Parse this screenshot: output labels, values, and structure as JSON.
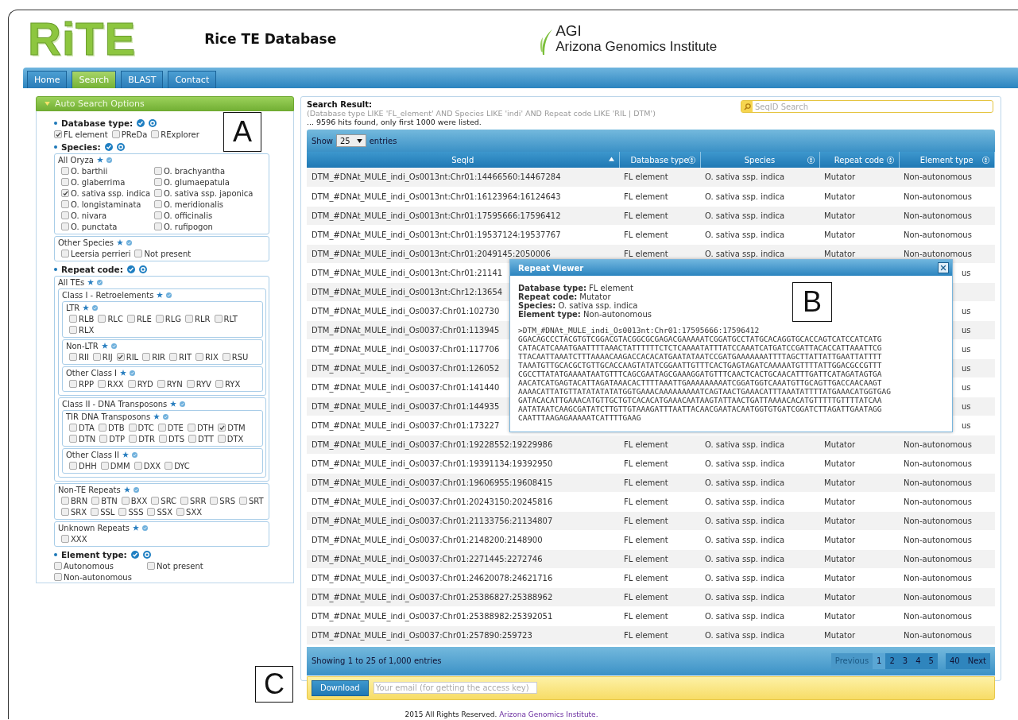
{
  "header": {
    "logo": "RiTE",
    "site_title": "Rice TE Database",
    "org_short": "AGI",
    "org_name": "Arizona Genomics Institute"
  },
  "nav": [
    {
      "label": "Home",
      "selected": false
    },
    {
      "label": "Search",
      "selected": true
    },
    {
      "label": "BLAST",
      "selected": false
    },
    {
      "label": "Contact",
      "selected": false
    }
  ],
  "sidebar": {
    "title": "Auto Search Options",
    "expanded": true,
    "figure_label": "A",
    "sections": [
      {
        "label": "Database type:",
        "kind": "row",
        "options": [
          {
            "label": "FL element",
            "checked": true
          },
          {
            "label": "PReDa",
            "checked": false
          },
          {
            "label": "RExplorer",
            "checked": false
          }
        ]
      },
      {
        "label": "Species:",
        "groups": [
          {
            "label": "All Oryza",
            "kind": "columns",
            "options": [
              {
                "label": "O. barthii",
                "checked": false
              },
              {
                "label": "O. brachyantha",
                "checked": false
              },
              {
                "label": "O. glaberrima",
                "checked": false
              },
              {
                "label": "O. glumaepatula",
                "checked": false
              },
              {
                "label": "O. sativa ssp. indica",
                "checked": true
              },
              {
                "label": "O. sativa ssp. japonica",
                "checked": false
              },
              {
                "label": "O. longistaminata",
                "checked": false
              },
              {
                "label": "O. meridionalis",
                "checked": false
              },
              {
                "label": "O. nivara",
                "checked": false
              },
              {
                "label": "O. officinalis",
                "checked": false
              },
              {
                "label": "O. punctata",
                "checked": false
              },
              {
                "label": "O. rufipogon",
                "checked": false
              }
            ]
          },
          {
            "label": "Other Species",
            "kind": "row",
            "options": [
              {
                "label": "Leersia perrieri",
                "checked": false
              },
              {
                "label": "Not present",
                "checked": false
              }
            ]
          }
        ]
      },
      {
        "label": "Repeat code:",
        "groups": [
          {
            "label": "All TEs",
            "children": [
              {
                "label": "Class I - Retroelements",
                "children": [
                  {
                    "label": "LTR",
                    "kind": "row",
                    "options": [
                      {
                        "label": "RLB",
                        "checked": false
                      },
                      {
                        "label": "RLC",
                        "checked": false
                      },
                      {
                        "label": "RLE",
                        "checked": false
                      },
                      {
                        "label": "RLG",
                        "checked": false
                      },
                      {
                        "label": "RLR",
                        "checked": false
                      },
                      {
                        "label": "RLT",
                        "checked": false
                      },
                      {
                        "label": "RLX",
                        "checked": false
                      }
                    ]
                  },
                  {
                    "label": "Non-LTR",
                    "kind": "row",
                    "options": [
                      {
                        "label": "RII",
                        "checked": false
                      },
                      {
                        "label": "RIJ",
                        "checked": false
                      },
                      {
                        "label": "RIL",
                        "checked": true
                      },
                      {
                        "label": "RIR",
                        "checked": false
                      },
                      {
                        "label": "RIT",
                        "checked": false
                      },
                      {
                        "label": "RIX",
                        "checked": false
                      },
                      {
                        "label": "RSU",
                        "checked": false
                      }
                    ]
                  },
                  {
                    "label": "Other Class I",
                    "kind": "row",
                    "options": [
                      {
                        "label": "RPP",
                        "checked": false
                      },
                      {
                        "label": "RXX",
                        "checked": false
                      },
                      {
                        "label": "RYD",
                        "checked": false
                      },
                      {
                        "label": "RYN",
                        "checked": false
                      },
                      {
                        "label": "RYV",
                        "checked": false
                      },
                      {
                        "label": "RYX",
                        "checked": false
                      }
                    ]
                  }
                ]
              },
              {
                "label": "Class II - DNA Transposons",
                "children": [
                  {
                    "label": "TIR DNA Transposons",
                    "kind": "row",
                    "options": [
                      {
                        "label": "DTA",
                        "checked": false
                      },
                      {
                        "label": "DTB",
                        "checked": false
                      },
                      {
                        "label": "DTC",
                        "checked": false
                      },
                      {
                        "label": "DTE",
                        "checked": false
                      },
                      {
                        "label": "DTH",
                        "checked": false
                      },
                      {
                        "label": "DTM",
                        "checked": true
                      },
                      {
                        "label": "DTN",
                        "checked": false
                      },
                      {
                        "label": "DTP",
                        "checked": false
                      },
                      {
                        "label": "DTR",
                        "checked": false
                      },
                      {
                        "label": "DTS",
                        "checked": false
                      },
                      {
                        "label": "DTT",
                        "checked": false
                      },
                      {
                        "label": "DTX",
                        "checked": false
                      }
                    ]
                  },
                  {
                    "label": "Other Class II",
                    "kind": "row",
                    "options": [
                      {
                        "label": "DHH",
                        "checked": false
                      },
                      {
                        "label": "DMM",
                        "checked": false
                      },
                      {
                        "label": "DXX",
                        "checked": false
                      },
                      {
                        "label": "DYC",
                        "checked": false
                      }
                    ]
                  }
                ]
              }
            ]
          },
          {
            "label": "Non-TE Repeats",
            "kind": "row",
            "options": [
              {
                "label": "BRN",
                "checked": false
              },
              {
                "label": "BTN",
                "checked": false
              },
              {
                "label": "BXX",
                "checked": false
              },
              {
                "label": "SRC",
                "checked": false
              },
              {
                "label": "SRR",
                "checked": false
              },
              {
                "label": "SRS",
                "checked": false
              },
              {
                "label": "SRT",
                "checked": false
              },
              {
                "label": "SRX",
                "checked": false
              },
              {
                "label": "SSL",
                "checked": false
              },
              {
                "label": "SSS",
                "checked": false
              },
              {
                "label": "SSX",
                "checked": false
              },
              {
                "label": "SXX",
                "checked": false
              }
            ]
          },
          {
            "label": "Unknown Repeats",
            "kind": "row",
            "options": [
              {
                "label": "XXX",
                "checked": false
              }
            ]
          }
        ]
      },
      {
        "label": "Element type:",
        "kind": "columns",
        "options": [
          {
            "label": "Autonomous",
            "checked": false
          },
          {
            "label": "Not present",
            "checked": false
          },
          {
            "label": "Non-autonomous",
            "checked": false
          }
        ]
      }
    ]
  },
  "results": {
    "title": "Search Result:",
    "query": "(Database type LIKE 'FL_element' AND Species LIKE 'indi' AND Repeat code LIKE 'RIL | DTM')",
    "hits": "... 9596 hits found, only first 1000 were listed.",
    "search_placeholder": "SeqID Search",
    "show_label": "Show",
    "page_size": "25",
    "entries_label": "entries",
    "columns": [
      {
        "label": "SeqId",
        "sorted": true
      },
      {
        "label": "Database type",
        "sorted": false
      },
      {
        "label": "Species",
        "sorted": false
      },
      {
        "label": "Repeat code",
        "sorted": false
      },
      {
        "label": "Element type",
        "sorted": false
      }
    ],
    "rows": [
      {
        "seq_id": "DTM_#DNAt_MULE_indi_Os0013nt:Chr01:14466560:14467284",
        "database_type": "FL element",
        "species": "O. sativa ssp. indica",
        "repeat_code": "Mutator",
        "element_type": "Non-autonomous"
      },
      {
        "seq_id": "DTM_#DNAt_MULE_indi_Os0013nt:Chr01:16123964:16124643",
        "database_type": "FL element",
        "species": "O. sativa ssp. indica",
        "repeat_code": "Mutator",
        "element_type": "Non-autonomous"
      },
      {
        "seq_id": "DTM_#DNAt_MULE_indi_Os0013nt:Chr01:17595666:17596412",
        "database_type": "FL element",
        "species": "O. sativa ssp. indica",
        "repeat_code": "Mutator",
        "element_type": "Non-autonomous"
      },
      {
        "seq_id": "DTM_#DNAt_MULE_indi_Os0013nt:Chr01:19537124:19537767",
        "database_type": "FL element",
        "species": "O. sativa ssp. indica",
        "repeat_code": "Mutator",
        "element_type": "Non-autonomous"
      },
      {
        "seq_id": "DTM_#DNAt_MULE_indi_Os0013nt:Chr01:2049145:2050006",
        "database_type": "FL element",
        "species": "O. sativa ssp. indica",
        "repeat_code": "Mutator",
        "element_type": "Non-autonomous"
      },
      {
        "seq_id": "DTM_#DNAt_MULE_indi_Os0013nt:Chr01:21141",
        "element_tail": "us"
      },
      {
        "seq_id": "DTM_#DNAt_MULE_indi_Os0013nt:Chr12:13654"
      },
      {
        "seq_id": "DTM_#DNAt_MULE_indi_Os0037:Chr01:102730",
        "element_tail": "us"
      },
      {
        "seq_id": "DTM_#DNAt_MULE_indi_Os0037:Chr01:113945",
        "element_tail": "us"
      },
      {
        "seq_id": "DTM_#DNAt_MULE_indi_Os0037:Chr01:117706",
        "element_tail": "us"
      },
      {
        "seq_id": "DTM_#DNAt_MULE_indi_Os0037:Chr01:126052",
        "element_tail": "us"
      },
      {
        "seq_id": "DTM_#DNAt_MULE_indi_Os0037:Chr01:141440",
        "element_tail": "us"
      },
      {
        "seq_id": "DTM_#DNAt_MULE_indi_Os0037:Chr01:144935",
        "element_tail": "us"
      },
      {
        "seq_id": "DTM_#DNAt_MULE_indi_Os0037:Chr01:173227",
        "element_tail": "us"
      },
      {
        "seq_id": "DTM_#DNAt_MULE_indi_Os0037:Chr01:19228552:19229986",
        "database_type": "FL element",
        "species": "O. sativa ssp. indica",
        "repeat_code": "Mutator",
        "element_type": "Non-autonomous"
      },
      {
        "seq_id": "DTM_#DNAt_MULE_indi_Os0037:Chr01:19391134:19392950",
        "database_type": "FL element",
        "species": "O. sativa ssp. indica",
        "repeat_code": "Mutator",
        "element_type": "Non-autonomous"
      },
      {
        "seq_id": "DTM_#DNAt_MULE_indi_Os0037:Chr01:19606955:19608415",
        "database_type": "FL element",
        "species": "O. sativa ssp. indica",
        "repeat_code": "Mutator",
        "element_type": "Non-autonomous"
      },
      {
        "seq_id": "DTM_#DNAt_MULE_indi_Os0037:Chr01:20243150:20245816",
        "database_type": "FL element",
        "species": "O. sativa ssp. indica",
        "repeat_code": "Mutator",
        "element_type": "Non-autonomous"
      },
      {
        "seq_id": "DTM_#DNAt_MULE_indi_Os0037:Chr01:21133756:21134807",
        "database_type": "FL element",
        "species": "O. sativa ssp. indica",
        "repeat_code": "Mutator",
        "element_type": "Non-autonomous"
      },
      {
        "seq_id": "DTM_#DNAt_MULE_indi_Os0037:Chr01:2148200:2148900",
        "database_type": "FL element",
        "species": "O. sativa ssp. indica",
        "repeat_code": "Mutator",
        "element_type": "Non-autonomous"
      },
      {
        "seq_id": "DTM_#DNAt_MULE_indi_Os0037:Chr01:2271445:2272746",
        "database_type": "FL element",
        "species": "O. sativa ssp. indica",
        "repeat_code": "Mutator",
        "element_type": "Non-autonomous"
      },
      {
        "seq_id": "DTM_#DNAt_MULE_indi_Os0037:Chr01:24620078:24621716",
        "database_type": "FL element",
        "species": "O. sativa ssp. indica",
        "repeat_code": "Mutator",
        "element_type": "Non-autonomous"
      },
      {
        "seq_id": "DTM_#DNAt_MULE_indi_Os0037:Chr01:25386827:25388962",
        "database_type": "FL element",
        "species": "O. sativa ssp. indica",
        "repeat_code": "Mutator",
        "element_type": "Non-autonomous"
      },
      {
        "seq_id": "DTM_#DNAt_MULE_indi_Os0037:Chr01:25388982:25392051",
        "database_type": "FL element",
        "species": "O. sativa ssp. indica",
        "repeat_code": "Mutator",
        "element_type": "Non-autonomous"
      },
      {
        "seq_id": "DTM_#DNAt_MULE_indi_Os0037:Chr01:257890:259723",
        "database_type": "FL element",
        "species": "O. sativa ssp. indica",
        "repeat_code": "Mutator",
        "element_type": "Non-autonomous"
      }
    ],
    "summary": "Showing 1 to 25 of 1,000 entries",
    "pages": [
      {
        "label": "Previous",
        "selected": false,
        "disabled": true
      },
      {
        "label": "1",
        "selected": true,
        "disabled": false
      },
      {
        "label": "2",
        "selected": false,
        "disabled": false
      },
      {
        "label": "3",
        "selected": false,
        "disabled": false
      },
      {
        "label": "4",
        "selected": false,
        "disabled": false
      },
      {
        "label": "5",
        "selected": false,
        "disabled": false
      },
      {
        "label": "40",
        "selected": false,
        "disabled": false
      },
      {
        "label": "Next",
        "selected": false,
        "disabled": false
      }
    ],
    "download_button": "Download",
    "email_placeholder": "Your email (for getting the access key)",
    "figure_label": "C"
  },
  "dialog": {
    "title": "Repeat Viewer",
    "figure_label": "B",
    "info": [
      "**Database type:** FL element",
      "**Repeat code:** Mutator",
      "**Species:** O. sativa ssp. indica",
      "**Element type:** Non-autonomous"
    ],
    "sequence_lines": [
      ">DTM_#DNAt_MULE_indi_Os0013nt:Chr01:17595666:17596412",
      "GGACAGCCCTACGTGTCGGACGTACGGCGCGAGACGAAAAATCGGATGCCTATGCACAGGTGCACCAGTCATCCATCATG",
      "CATACATCAAATGAATTTTAAACTATTTTTTCTCTCAAAATATTTATCCAAATCATGATCCGATTACACCATTAAATTCG",
      "TTACAATTAAATCTTTAAAACAAGACCACACATGAATATAATCCGATGAAAAAAATTTTAGCTTATTATTGAATTATTTT",
      "TAAATGTTGCACGCTGTTGCACCAAGTATATCGGAATTGTTTCACTGAGTAGATCAAAAATGTTTTATTGGACGCCGTTT",
      "CGCCTTATATGAAAATAATGTTTCAGCGAATAGCGAAAGGATGTTTCAACTCACTGCAACATTTGATTCATAGATAGTGA",
      "AACATCATGAGTACATTAGATAAACACTTTTAAATTGAAAAAAAAATCGGATGGTCAAATGTTGCAGTTGACCAACAAGT",
      "AAAACATTATGTTATATATATATGGTGAAACAAAAAAAAATCAGTAACTGAAACATTTAAATATTTTATGAAACATGGTGAG",
      "GATACACATTGAAACATGTTGCTGTCACACATGAAACAATAAGTATTAACTGATTAAAACACATGTTTTTGTTTTATCAA",
      "AATATAATCAAGCGATATCTTGTTGTAAAGATTTAATTACAACGAATACAATGGTGTGATCGGATCTTAGATTGAATAGG",
      "CAATTTAAGAGAAAAATCATTTTGAAG"
    ]
  },
  "footer": {
    "text": "2015 All Rights Reserved.",
    "link": "Arizona Genomics Institute."
  }
}
